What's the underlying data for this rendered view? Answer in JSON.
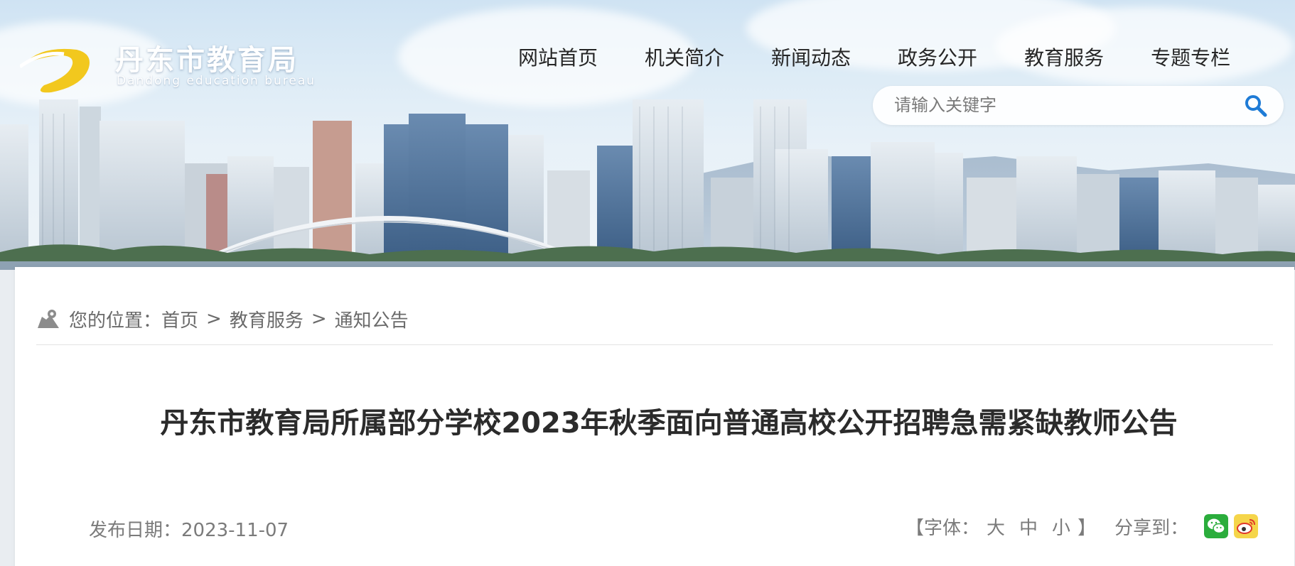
{
  "site": {
    "name_cn": "丹东市教育局",
    "name_en": "Dandong education bureau"
  },
  "nav": {
    "items": [
      {
        "label": "网站首页"
      },
      {
        "label": "机关简介"
      },
      {
        "label": "新闻动态"
      },
      {
        "label": "政务公开"
      },
      {
        "label": "教育服务"
      },
      {
        "label": "专题专栏"
      }
    ]
  },
  "search": {
    "placeholder": "请输入关键字",
    "icon": "search-icon"
  },
  "breadcrumb": {
    "icon": "map-location-icon",
    "prefix": "您的位置：",
    "items": [
      "首页",
      "教育服务",
      "通知公告"
    ],
    "separator": ">"
  },
  "article": {
    "title": "丹东市教育局所属部分学校2023年秋季面向普通高校公开招聘急需紧缺教师公告",
    "date_label": "发布日期：2023-11-07",
    "font_label_open": "【字体：",
    "font_large": "大",
    "font_medium": "中",
    "font_small": "小",
    "font_label_close": "】",
    "share_label": "分享到：",
    "share_icons": [
      "wechat-icon",
      "weibo-icon"
    ]
  },
  "colors": {
    "wechat": "#2bad3c",
    "weibo": "#f5d54a",
    "search_icon": "#1e7bd6",
    "logo_swoosh": "#f2c81e"
  }
}
